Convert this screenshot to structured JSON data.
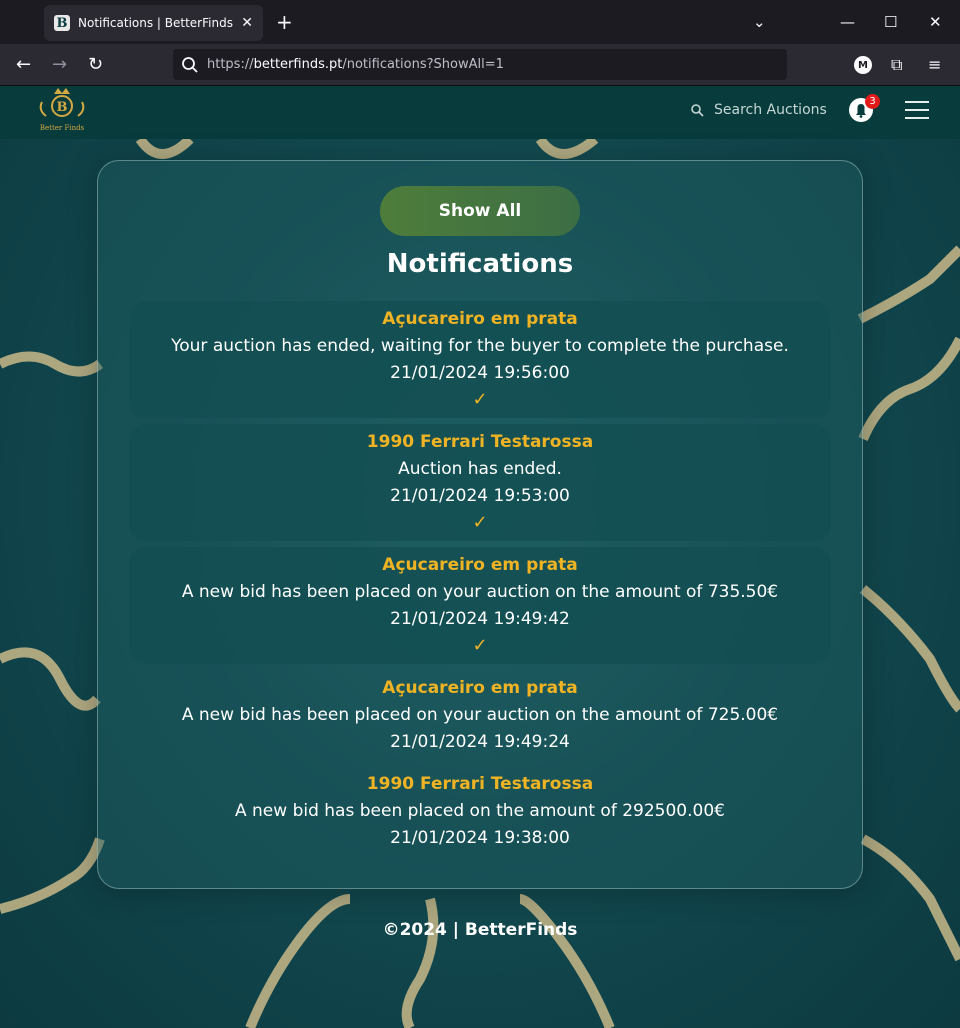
{
  "browser": {
    "tab_title": "Notifications | BetterFinds",
    "tab_favicon_letter": "B",
    "url_scheme": "https://",
    "url_host": "betterfinds.pt",
    "url_path": "/notifications?ShowAll=1",
    "ext_letter": "M"
  },
  "header": {
    "logo_text": "Better Finds",
    "logo_letter": "B",
    "search_placeholder": "Search Auctions",
    "notification_count": "3"
  },
  "main": {
    "show_all_label": "Show All",
    "heading": "Notifications",
    "notifications": [
      {
        "title": "Açucareiro em prata",
        "message": "Your auction has ended, waiting for the buyer to complete the purchase.",
        "time": "21/01/2024 19:56:00",
        "check": "✓"
      },
      {
        "title": "1990 Ferrari Testarossa",
        "message": "Auction has ended.",
        "time": "21/01/2024 19:53:00",
        "check": "✓"
      },
      {
        "title": "Açucareiro em prata",
        "message": "A new bid has been placed on your auction on the amount of 735.50€",
        "time": "21/01/2024 19:49:42",
        "check": "✓"
      },
      {
        "title": "Açucareiro em prata",
        "message": "A new bid has been placed on your auction on the amount of 725.00€",
        "time": "21/01/2024 19:49:24"
      },
      {
        "title": "1990 Ferrari Testarossa",
        "message": "A new bid has been placed on the amount of 292500.00€",
        "time": "21/01/2024 19:38:00"
      }
    ]
  },
  "footer": {
    "text": "©2024 | BetterFinds"
  },
  "colors": {
    "accent": "#f0b323",
    "header_bg": "#083c3c",
    "badge": "#e11b1b"
  }
}
